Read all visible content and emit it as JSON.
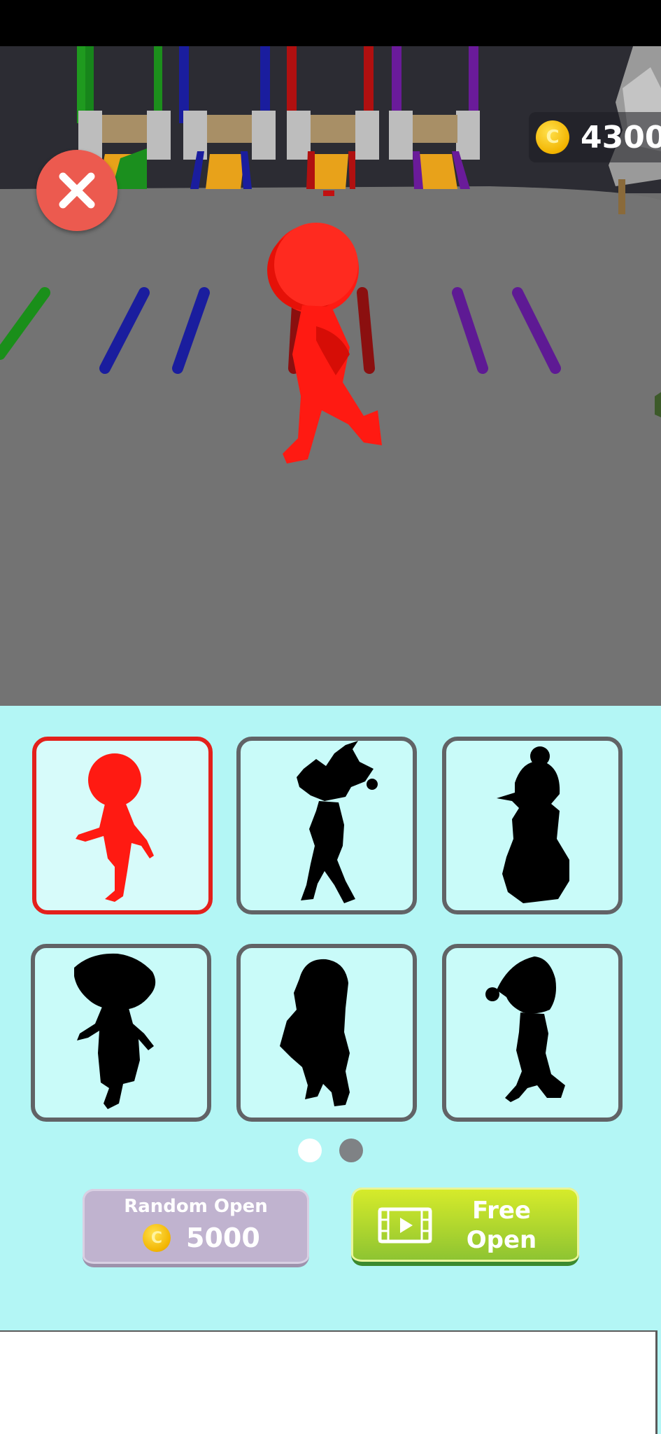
{
  "status_bar": {},
  "hud": {
    "close_icon": "close-x-icon",
    "coin_icon": "gold-coin-icon",
    "coins": "4300"
  },
  "skins": {
    "page": 1,
    "pages_total": 2,
    "items": [
      {
        "state": "selected",
        "unlocked": true
      },
      {
        "state": "locked",
        "unlocked": false
      },
      {
        "state": "locked",
        "unlocked": false
      },
      {
        "state": "locked",
        "unlocked": false
      },
      {
        "state": "locked",
        "unlocked": false
      },
      {
        "state": "locked",
        "unlocked": false
      }
    ]
  },
  "buttons": {
    "random_open_label": "Random Open",
    "random_open_price": "5000",
    "free_open_line1": "Free",
    "free_open_line2": "Open",
    "video_icon": "video-ad-icon"
  },
  "colors": {
    "player": "#ff1a12",
    "panel_bg": "#b3f6f5",
    "selected_border": "#e3201b",
    "card_border": "#616366",
    "free_button": "#a8d62e",
    "random_button": "#c0b3cf"
  }
}
